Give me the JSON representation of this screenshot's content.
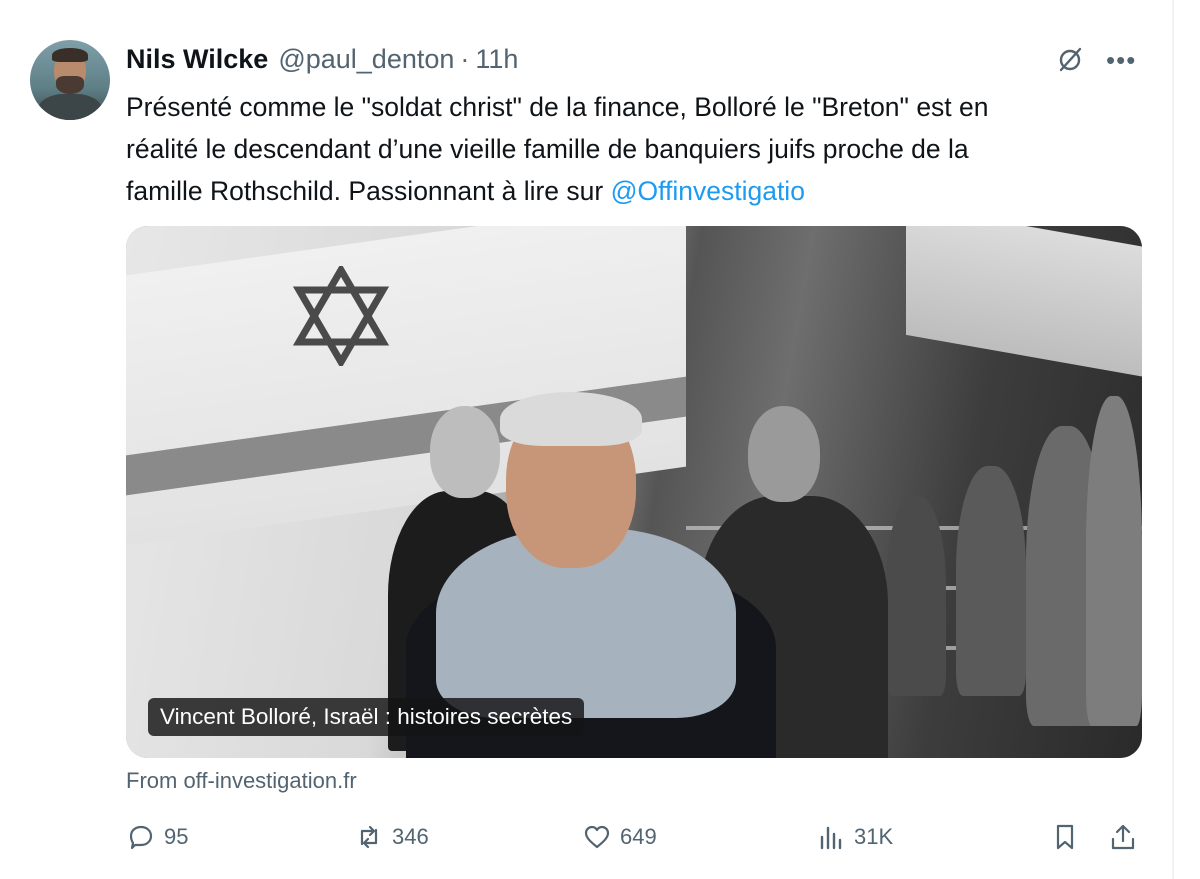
{
  "author": {
    "name": "Nils Wilcke",
    "handle": "@paul_denton",
    "separator": "·",
    "time": "11h"
  },
  "tweet": {
    "text_line1": "Présenté comme le \"soldat christ\" de la finance, Bolloré le \"Breton\" est en",
    "text_line2": "réalité le descendant d’une vieille famille de banquiers juifs proche de la",
    "text_line3_prefix": "famille Rothschild. Passionnant à lire sur ",
    "mention": "@Offinvestigatio"
  },
  "card": {
    "caption": "Vincent Bolloré, Israël : histoires secrètes",
    "source": "From off-investigation.fr"
  },
  "actions": {
    "replies": "95",
    "reposts": "346",
    "likes": "649",
    "views": "31K"
  },
  "colors": {
    "text": "#0f1419",
    "secondary": "#536471",
    "accent": "#1d9bf0"
  },
  "icons": {
    "top": [
      "grok-icon",
      "more-icon"
    ],
    "actions": [
      "reply-icon",
      "repost-icon",
      "like-icon",
      "views-icon",
      "bookmark-icon",
      "share-icon"
    ]
  }
}
